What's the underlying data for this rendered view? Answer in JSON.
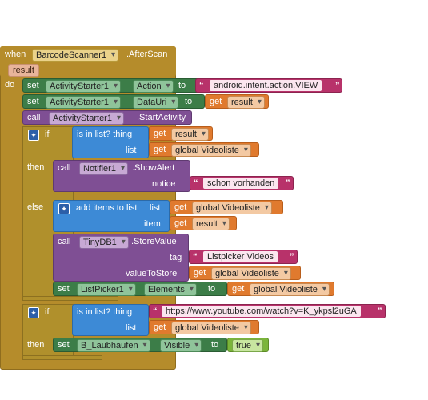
{
  "event": {
    "when": "when",
    "component": "BarcodeScanner1",
    "event_name": ".AfterScan",
    "param": "result",
    "do": "do"
  },
  "set1": {
    "set": "set",
    "component": "ActivityStarter1",
    "prop": "Action",
    "to": "to",
    "value": "android.intent.action.VIEW"
  },
  "set2": {
    "set": "set",
    "component": "ActivityStarter1",
    "prop": "DataUri",
    "to": "to",
    "get": "get",
    "var": "result"
  },
  "call1": {
    "call": "call",
    "component": "ActivityStarter1",
    "method": ".StartActivity"
  },
  "if1": {
    "if": "if",
    "then": "then",
    "else": "else",
    "test": "is in list? thing",
    "thing_get": "get",
    "thing_var": "result",
    "list_label": "list",
    "list_get": "get",
    "list_var": "global Videoliste"
  },
  "alert": {
    "call": "call",
    "component": "Notifier1",
    "method": ".ShowAlert",
    "notice_label": "notice",
    "notice_text": "schon vorhanden"
  },
  "additems": {
    "label": "add items to list",
    "list_label": "list",
    "list_get": "get",
    "list_var": "global Videoliste",
    "item_label": "item",
    "item_get": "get",
    "item_var": "result"
  },
  "store": {
    "call": "call",
    "component": "TinyDB1",
    "method": ".StoreValue",
    "tag_label": "tag",
    "tag_text": "Listpicker Videos",
    "value_label": "valueToStore",
    "value_get": "get",
    "value_var": "global Videoliste"
  },
  "set3": {
    "set": "set",
    "component": "ListPicker1",
    "prop": "Elements",
    "to": "to",
    "get": "get",
    "var": "global Videoliste"
  },
  "if2": {
    "if": "if",
    "then": "then",
    "test": "is in list? thing",
    "thing_text": "https://www.youtube.com/watch?v=K_ykpsl2uGA",
    "list_label": "list",
    "list_get": "get",
    "list_var": "global Videoliste"
  },
  "set4": {
    "set": "set",
    "component": "B_Laubhaufen",
    "prop": "Visible",
    "to": "to",
    "value": "true"
  },
  "colors": {
    "event": "#b58c2b",
    "component": "#3c7d48",
    "procedure": "#7f4f94",
    "list": "#3d8ad6",
    "variable": "#e07a2e",
    "text": "#b8326a",
    "logic": "#7bb53a"
  }
}
